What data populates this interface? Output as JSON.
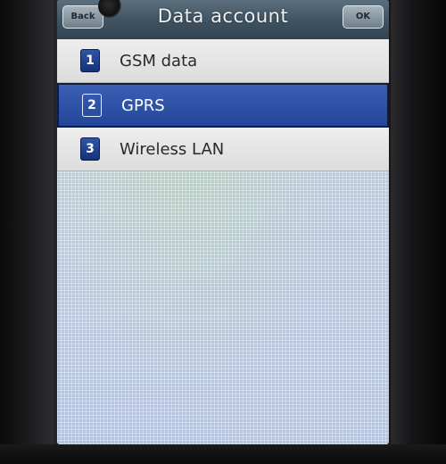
{
  "header": {
    "title": "Data account",
    "back_label": "Back",
    "ok_label": "OK"
  },
  "list": {
    "items": [
      {
        "number": "1",
        "label": "GSM data",
        "selected": false
      },
      {
        "number": "2",
        "label": "GPRS",
        "selected": true
      },
      {
        "number": "3",
        "label": "Wireless LAN",
        "selected": false
      }
    ]
  },
  "colors": {
    "selection": "#23469a",
    "badge": "#2f56a7",
    "title_bar": "#3f5261"
  }
}
